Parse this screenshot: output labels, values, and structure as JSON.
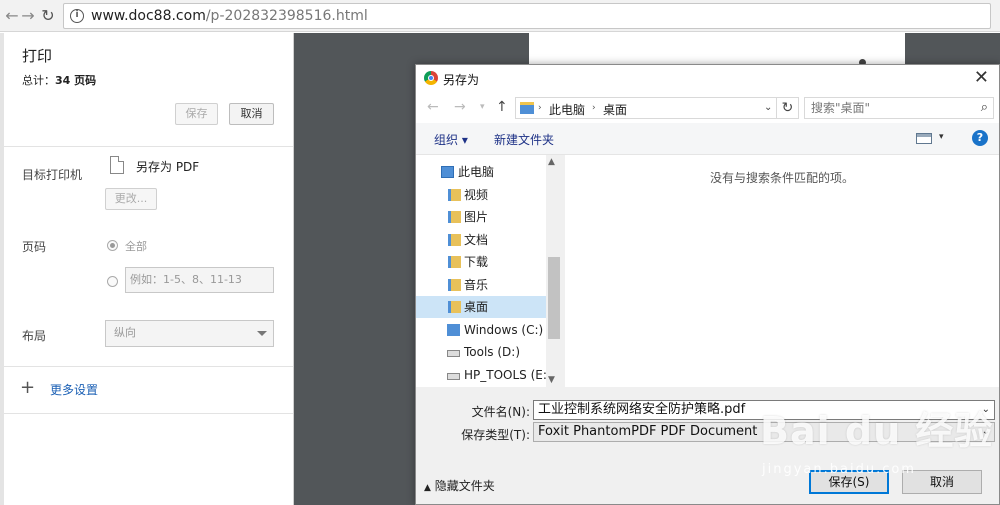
{
  "browser": {
    "url_host": "www.doc88.com",
    "url_path": "/p-202832398516.html"
  },
  "print_panel": {
    "title": "打印",
    "total_label": "总计：",
    "total_value": "34 页码",
    "save_label": "保存",
    "cancel_label": "取消",
    "destination_label": "目标打印机",
    "destination_value": "另存为 PDF",
    "change_label": "更改...",
    "pages_label": "页码",
    "pages_all_label": "全部",
    "pages_custom_placeholder": "例如：1-5、8、11-13",
    "layout_label": "布局",
    "layout_value": "纵向",
    "more_settings_label": "更多设置"
  },
  "dialog": {
    "title": "另存为",
    "breadcrumb": [
      "此电脑",
      "桌面"
    ],
    "search_placeholder": "搜索\"桌面\"",
    "organize_label": "组织 ▾",
    "new_folder_label": "新建文件夹",
    "tree": [
      {
        "label": "此电脑",
        "icon": "pc-icon"
      },
      {
        "label": "视频",
        "icon": "folder-icon"
      },
      {
        "label": "图片",
        "icon": "folder-icon"
      },
      {
        "label": "文档",
        "icon": "folder-icon"
      },
      {
        "label": "下载",
        "icon": "folder-icon"
      },
      {
        "label": "音乐",
        "icon": "folder-icon"
      },
      {
        "label": "桌面",
        "icon": "folder-icon",
        "selected": true
      },
      {
        "label": "Windows (C:)",
        "icon": "drive-icon"
      },
      {
        "label": "Tools (D:)",
        "icon": "drive-icon"
      },
      {
        "label": "HP_TOOLS (E:)",
        "icon": "drive-icon"
      }
    ],
    "empty_message": "没有与搜索条件匹配的项。",
    "filename_label": "文件名(N):",
    "filename_value": "工业控制系统网络安全防护策略.pdf",
    "filetype_label": "保存类型(T):",
    "filetype_value": "Foxit PhantomPDF PDF Document",
    "hide_folders_label": "隐藏文件夹",
    "save_label": "保存(S)",
    "cancel_label": "取消"
  },
  "watermark": {
    "main": "Bai du 经验",
    "sub": "jingyan.baidu.com"
  }
}
